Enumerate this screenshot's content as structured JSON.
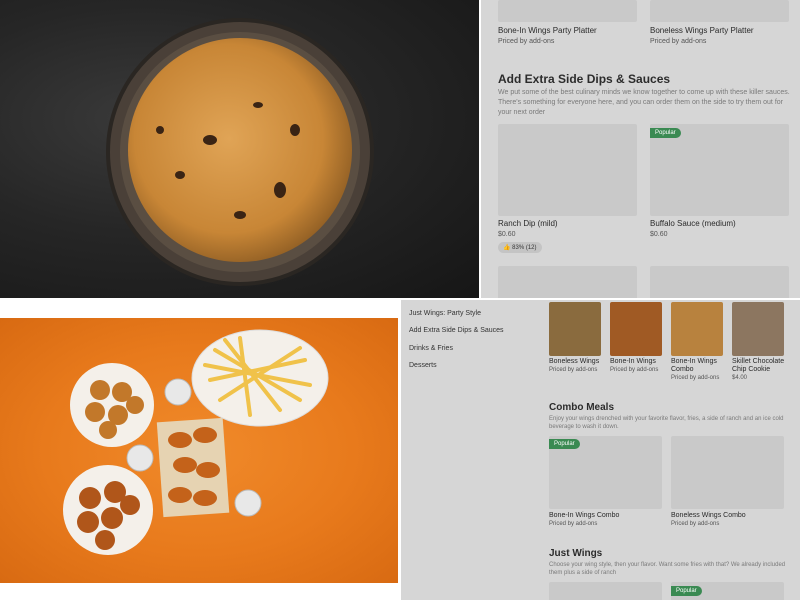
{
  "top_right": {
    "platter_items": [
      {
        "name": "Bone-In Wings Party Platter",
        "price": "Priced by add-ons"
      },
      {
        "name": "Boneless Wings Party Platter",
        "price": "Priced by add-ons"
      }
    ],
    "section_title": "Add Extra Side Dips & Sauces",
    "section_desc": "We put some of the best culinary minds we know together to come up with these killer sauces. There's something for everyone here, and you can order them on the side to try them out for your next order",
    "dips": [
      {
        "name": "Ranch Dip (mild)",
        "price": "$0.60",
        "rating": "83% (12)",
        "badge": ""
      },
      {
        "name": "Buffalo Sauce (medium)",
        "price": "$0.60",
        "rating": "",
        "badge": "Popular"
      }
    ]
  },
  "bottom_right": {
    "nav": [
      "Just Wings: Party Style",
      "Add Extra Side Dips & Sauces",
      "Drinks & Fries",
      "Desserts"
    ],
    "featured": [
      {
        "name": "Boneless Wings",
        "price": "Priced by add-ons"
      },
      {
        "name": "Bone-In Wings",
        "price": "Priced by add-ons"
      },
      {
        "name": "Bone-In Wings Combo",
        "price": "Priced by add-ons"
      },
      {
        "name": "Skillet Chocolate Chip Cookie",
        "price": "$4.00"
      }
    ],
    "combo_title": "Combo Meals",
    "combo_desc": "Enjoy your wings drenched with your favorite flavor, fries, a side of ranch and an ice cold beverage to wash it down.",
    "combos": [
      {
        "name": "Bone-In Wings Combo",
        "price": "Priced by add-ons",
        "badge": "Popular"
      },
      {
        "name": "Boneless Wings Combo",
        "price": "Priced by add-ons",
        "badge": ""
      }
    ],
    "just_title": "Just Wings",
    "just_desc": "Choose your wing style, then your flavor. Want some fries with that? We already included them plus a side of ranch",
    "just_badge": "Popular"
  },
  "colors": {
    "badge_green": "#3a8a52",
    "panel_grey": "#d6d6d6",
    "orange_bg": "#e87a1c"
  }
}
